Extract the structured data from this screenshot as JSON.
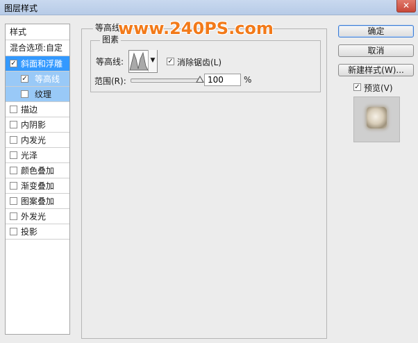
{
  "window": {
    "title": "图层样式",
    "close_glyph": "✕"
  },
  "sidebar": {
    "header": "样式",
    "blend_options": "混合选项:自定",
    "items": [
      {
        "label": "斜面和浮雕",
        "checked": true,
        "selected": true
      },
      {
        "label": "等高线",
        "checked": true,
        "sub": true,
        "selected": true
      },
      {
        "label": "纹理",
        "checked": false,
        "sub": true
      },
      {
        "label": "描边",
        "checked": false
      },
      {
        "label": "内阴影",
        "checked": false
      },
      {
        "label": "内发光",
        "checked": false
      },
      {
        "label": "光泽",
        "checked": false
      },
      {
        "label": "颜色叠加",
        "checked": false
      },
      {
        "label": "渐变叠加",
        "checked": false
      },
      {
        "label": "图案叠加",
        "checked": false
      },
      {
        "label": "外发光",
        "checked": false
      },
      {
        "label": "投影",
        "checked": false
      }
    ]
  },
  "panel": {
    "section_title": "等高线",
    "group_title": "图素",
    "contour_label": "等高线:",
    "antialias_label": "消除锯齿(L)",
    "antialias_checked": true,
    "range_label": "范围(R):",
    "range_value": "100",
    "range_unit": "%",
    "range_level_percent": 100
  },
  "buttons": {
    "ok": "确定",
    "cancel": "取消",
    "new_style": "新建样式(W)...",
    "preview_label": "预览(V)",
    "preview_checked": true
  },
  "watermark": "www.240PS.com",
  "icons": {
    "check": "✓",
    "dropdown": "▼"
  },
  "colors": {
    "selection": "#3399ff",
    "sub_selection": "#99c9f7",
    "watermark": "#f27a1a"
  }
}
